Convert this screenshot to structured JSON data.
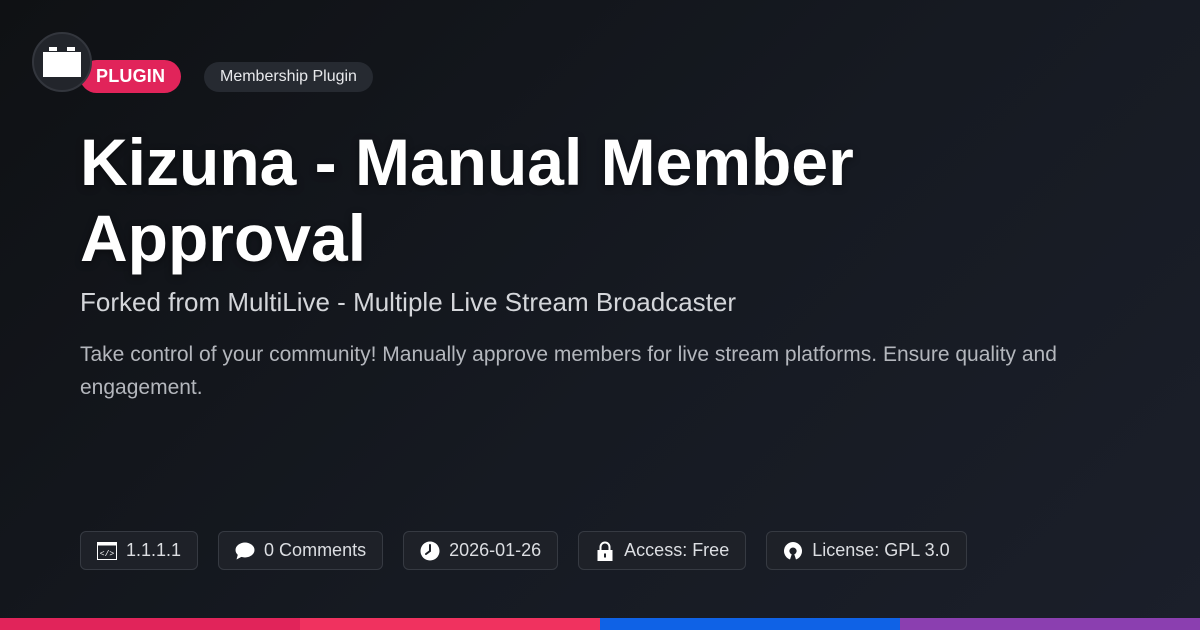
{
  "badge": {
    "label": "PLUGIN",
    "color": "#e1245a"
  },
  "category": {
    "label": "Membership Plugin"
  },
  "title": "Kizuna - Manual Member Approval",
  "subtitle": "Forked from MultiLive - Multiple Live Stream Broadcaster",
  "description": "Take control of your community! Manually approve members for live stream platforms. Ensure quality and engagement.",
  "meta": {
    "version": {
      "icon": "code-window-icon",
      "label": "1.1.1.1"
    },
    "comments": {
      "icon": "speech-bubble-icon",
      "label": "0 Comments"
    },
    "date": {
      "icon": "clock-icon",
      "label": "2026-01-26"
    },
    "access": {
      "icon": "lock-icon",
      "label": "Access: Free"
    },
    "license": {
      "icon": "open-source-icon",
      "label": "License: GPL 3.0"
    }
  },
  "footer_colors": [
    "#e1245a",
    "#f0325f",
    "#0f62e6",
    "#8b3fb0"
  ]
}
